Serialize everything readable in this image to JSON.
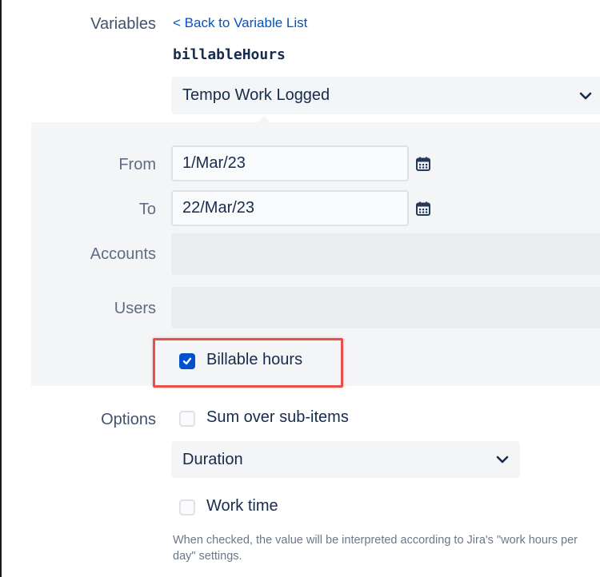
{
  "variables_label": "Variables",
  "back_link": "< Back to Variable List",
  "variable_name": "billableHours",
  "source_select": {
    "value": "Tempo Work Logged"
  },
  "from": {
    "label": "From",
    "value": "1/Mar/23"
  },
  "to": {
    "label": "To",
    "value": "22/Mar/23"
  },
  "accounts": {
    "label": "Accounts"
  },
  "users": {
    "label": "Users"
  },
  "billable": {
    "label": "Billable hours",
    "checked": true
  },
  "options": {
    "label": "Options",
    "sum_over_subitems": {
      "label": "Sum over sub-items",
      "checked": false
    },
    "format_select": {
      "value": "Duration"
    },
    "work_time": {
      "label": "Work time",
      "checked": false
    },
    "help_text": "When checked, the value will be interpreted according to Jira's \"work hours per day\" settings."
  },
  "colors": {
    "accent": "#0052cc",
    "highlight": "#e5504a",
    "panel": "#f4f5f7"
  },
  "icons": [
    "chevron-down-icon",
    "calendar-icon",
    "checkmark-icon"
  ]
}
